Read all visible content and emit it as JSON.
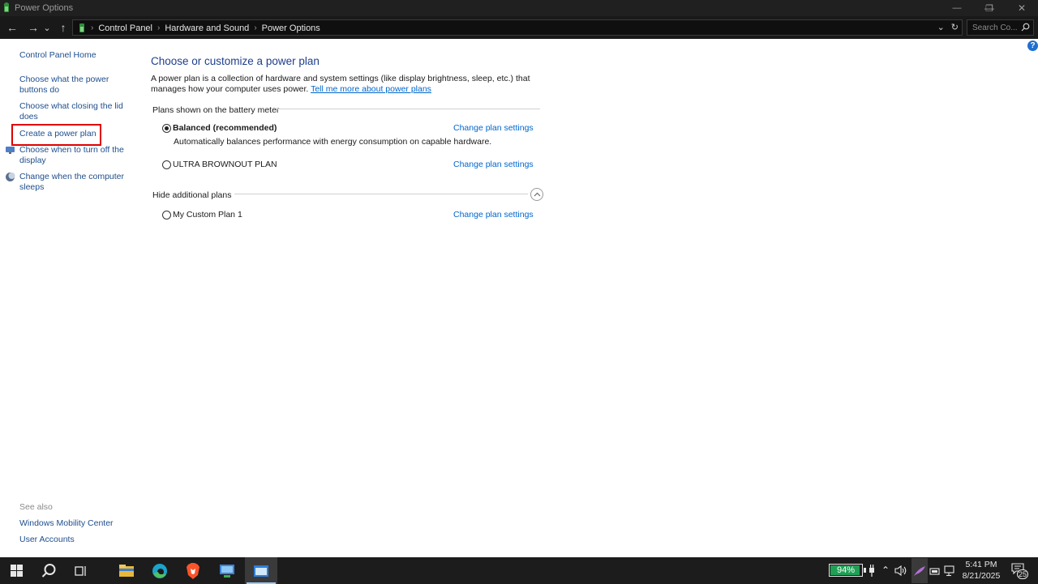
{
  "window": {
    "title": "Power Options",
    "minimize_glyph": "—",
    "restore_glyph": "❐",
    "close_glyph": "✕"
  },
  "nav": {
    "back_glyph": "←",
    "forward_glyph": "→",
    "recent_glyph": "⌄",
    "up_glyph": "↑",
    "breadcrumbs": [
      "Control Panel",
      "Hardware and Sound",
      "Power Options"
    ],
    "refresh_glyph": "↻",
    "dropdown_glyph": "⌄",
    "search_placeholder": "Search Co...",
    "search_glyph": "⚲"
  },
  "help_glyph": "?",
  "sidebar": {
    "home": "Control Panel Home",
    "items": [
      {
        "label_line1": "Choose what the power",
        "label_line2": "buttons do"
      },
      {
        "label_line1": "Choose what closing the lid",
        "label_line2": "does"
      },
      {
        "label_line1": "Create a power plan",
        "label_line2": ""
      },
      {
        "label_line1": "Choose when to turn off the",
        "label_line2": "display"
      },
      {
        "label_line1": "Change when the computer",
        "label_line2": "sleeps"
      }
    ],
    "see_also": "See also",
    "see_also_links": [
      "Windows Mobility Center",
      "User Accounts"
    ]
  },
  "main": {
    "title": "Choose or customize a power plan",
    "description_line1": "A power plan is a collection of hardware and system settings (like display brightness, sleep, etc.) that",
    "description_line2": "manages how your computer uses power.",
    "description_link": "Tell me more about power plans",
    "battery_section": "Plans shown on the battery meter",
    "hidden_section": "Hide additional plans",
    "plans": [
      {
        "name": "Balanced (recommended)",
        "selected": true,
        "description": "Automatically balances performance with energy consumption on capable hardware.",
        "link": "Change plan settings"
      },
      {
        "name": "ULTRA BROWNOUT PLAN",
        "selected": false,
        "description": "",
        "link": "Change plan settings"
      },
      {
        "name": "My Custom Plan 1",
        "selected": false,
        "description": "",
        "link": "Change plan settings"
      }
    ],
    "collapse_glyph": "︿"
  },
  "taskbar": {
    "battery_percent": "94%",
    "battery_level": 0.94,
    "time": "5:41 PM",
    "date": "8/21/2025",
    "notification_count": "25",
    "chevron_glyph": "⌃",
    "volume_glyph": "🔊"
  },
  "colors": {
    "accent": "#1e4e8c",
    "link": "#0066cc",
    "highlight": "#e00000",
    "battery": "#1fa055"
  }
}
